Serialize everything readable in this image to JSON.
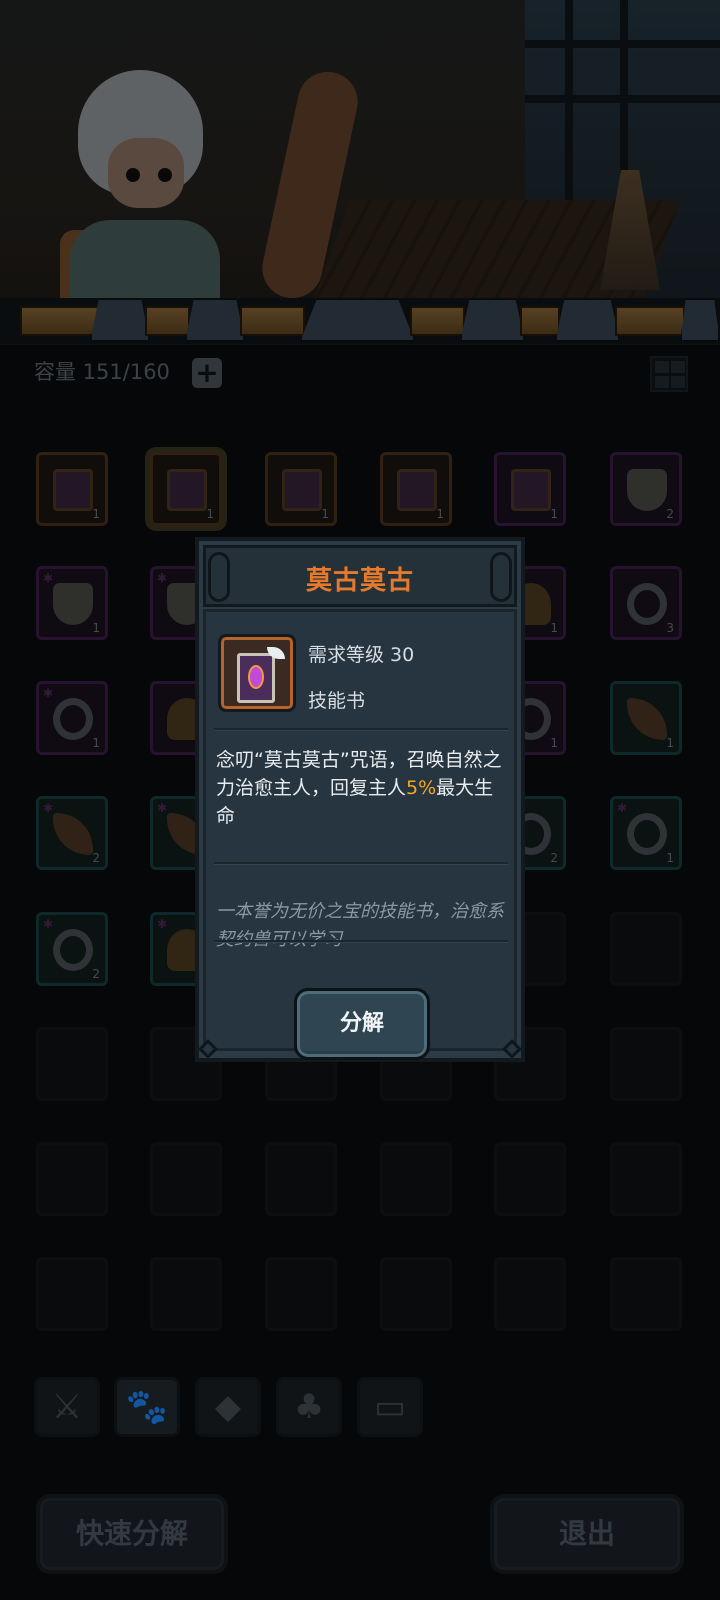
{
  "inventory": {
    "capacity_label": "容量 151/160",
    "add_capacity_icon": "plus-icon",
    "layout_toggle_icon": "grid-icon",
    "slots": [
      {
        "count": "1",
        "rarity": "orange",
        "kind": "book"
      },
      {
        "count": "1",
        "rarity": "orange",
        "kind": "book",
        "selected": true
      },
      {
        "count": "1",
        "rarity": "orange",
        "kind": "book"
      },
      {
        "count": "1",
        "rarity": "orange",
        "kind": "book"
      },
      {
        "count": "1",
        "rarity": "purple",
        "kind": "book"
      },
      {
        "count": "2",
        "rarity": "purple",
        "kind": "fang"
      },
      {
        "count": "1",
        "rarity": "purple",
        "kind": "fang",
        "starred": true
      },
      {
        "count": "",
        "rarity": "purple",
        "kind": "fang",
        "starred": true
      },
      {
        "count": "1",
        "rarity": "purple",
        "kind": "bell"
      },
      {
        "count": "3",
        "rarity": "purple",
        "kind": "ring"
      },
      {
        "count": "1",
        "rarity": "purple",
        "kind": "ring",
        "starred": true
      },
      {
        "count": "",
        "rarity": "purple",
        "kind": "bell"
      },
      {
        "count": "1",
        "rarity": "purple",
        "kind": "ring"
      },
      {
        "count": "1",
        "rarity": "teal",
        "kind": "claw"
      },
      {
        "count": "2",
        "rarity": "teal",
        "kind": "claw",
        "starred": true
      },
      {
        "count": "",
        "rarity": "teal",
        "kind": "claw",
        "starred": true
      },
      {
        "count": "2",
        "rarity": "teal",
        "kind": "ring"
      },
      {
        "count": "1",
        "rarity": "teal",
        "kind": "ring",
        "starred": true
      },
      {
        "count": "2",
        "rarity": "teal",
        "kind": "ring",
        "starred": true
      },
      {
        "count": "",
        "rarity": "teal",
        "kind": "bell",
        "starred": true
      }
    ],
    "categories": [
      {
        "icon": "weapon-icon"
      },
      {
        "icon": "paw-icon",
        "active": true
      },
      {
        "icon": "gem-icon"
      },
      {
        "icon": "leaf-icon"
      },
      {
        "icon": "chest-icon"
      }
    ],
    "quick_decompose_label": "快速分解",
    "exit_label": "退出"
  },
  "popup": {
    "item_name": "莫古莫古",
    "level_requirement": "需求等级 30",
    "item_type": "技能书",
    "description_parts": {
      "before": "念叨“莫古莫古”咒语，召唤自然之力治愈主人，回复主人",
      "highlight": "5%",
      "after": "最大生命"
    },
    "flavor_text": "一本誉为无价之宝的技能书，治愈系契约兽可以学习",
    "decompose_label": "分解"
  },
  "colors": {
    "title_orange": "#e7792b",
    "highlight_yellow": "#f2a622",
    "popup_bg": "#263540"
  }
}
